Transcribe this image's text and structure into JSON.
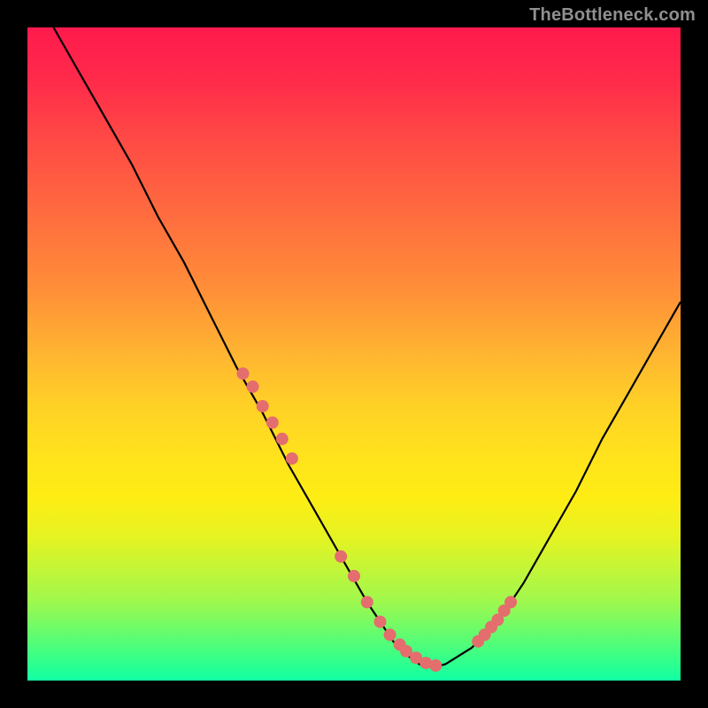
{
  "watermark": "TheBottleneck.com",
  "colors": {
    "background": "#000000",
    "gradient_top": "#ff1a4d",
    "gradient_mid": "#ffe31c",
    "gradient_bottom": "#11ffa4",
    "curve": "#000000",
    "marker": "#e46d6d"
  },
  "chart_data": {
    "type": "line",
    "title": "",
    "xlabel": "",
    "ylabel": "",
    "xlim": [
      0,
      100
    ],
    "ylim": [
      0,
      100
    ],
    "grid": false,
    "series": [
      {
        "name": "bottleneck-curve",
        "x": [
          4,
          8,
          12,
          16,
          20,
          24,
          28,
          32,
          36,
          40,
          44,
          48,
          52,
          56,
          58,
          60,
          62,
          64,
          68,
          72,
          76,
          80,
          84,
          88,
          92,
          96,
          100
        ],
        "y": [
          100,
          93,
          86,
          79,
          71,
          64,
          56,
          48,
          41,
          33,
          26,
          19,
          12,
          6,
          4,
          2.5,
          2,
          2.5,
          5,
          9,
          15,
          22,
          29,
          37,
          44,
          51,
          58
        ]
      }
    ],
    "markers": {
      "name": "highlight-dots",
      "x": [
        33,
        34.5,
        36,
        37.5,
        39,
        40.5,
        48,
        50,
        52,
        54,
        55.5,
        57,
        58,
        59.5,
        61,
        62.5,
        69,
        70,
        71,
        72,
        73,
        74
      ],
      "y": [
        47,
        45,
        42,
        39.5,
        37,
        34,
        19,
        16,
        12,
        9,
        7,
        5.5,
        4.5,
        3.5,
        2.7,
        2.3,
        6,
        7,
        8.2,
        9.3,
        10.7,
        12
      ]
    }
  }
}
